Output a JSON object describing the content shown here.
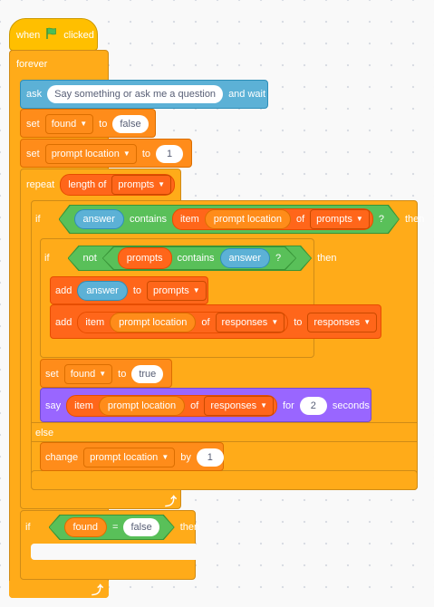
{
  "hat": {
    "when": "when",
    "clicked": "clicked",
    "flag": "green-flag-icon"
  },
  "forever": "forever",
  "ask": {
    "label": "ask",
    "question": "Say something or ask me a question",
    "and_wait": "and wait"
  },
  "set_found": {
    "label": "set",
    "var": "found",
    "to": "to",
    "value": "false"
  },
  "set_prompt": {
    "label": "set",
    "var": "prompt location",
    "to": "to",
    "value": "1"
  },
  "repeat": {
    "label": "repeat",
    "length_of": "length of",
    "list": "prompts"
  },
  "if1": {
    "if": "if",
    "answer": "answer",
    "contains": "contains",
    "item": "item",
    "prompt_location": "prompt location",
    "of": "of",
    "list": "prompts",
    "q": "?",
    "then": "then"
  },
  "if2": {
    "if": "if",
    "not": "not",
    "prompts": "prompts",
    "contains": "contains",
    "answer": "answer",
    "q": "?",
    "then": "then"
  },
  "add1": {
    "label": "add",
    "answer": "answer",
    "to": "to",
    "list": "prompts"
  },
  "add2": {
    "label": "add",
    "item": "item",
    "prompt_location": "prompt location",
    "of": "of",
    "list": "responses",
    "to": "to",
    "list2": "responses"
  },
  "set_true": {
    "label": "set",
    "var": "found",
    "to": "to",
    "value": "true"
  },
  "say": {
    "label": "say",
    "item": "item",
    "prompt_location": "prompt location",
    "of": "of",
    "list": "responses",
    "for": "for",
    "secs": "2",
    "seconds": "seconds"
  },
  "else": "else",
  "change": {
    "label": "change",
    "var": "prompt location",
    "by": "by",
    "value": "1"
  },
  "if3": {
    "if": "if",
    "found": "found",
    "eq": "=",
    "value": "false",
    "then": "then"
  },
  "colors": {
    "control": "#ffab19",
    "event": "#ffbf00",
    "sensing": "#5cb1d6",
    "variables": "#ff8c1a",
    "lists": "#ff661a",
    "operators": "#59c059",
    "looks": "#9966ff"
  }
}
